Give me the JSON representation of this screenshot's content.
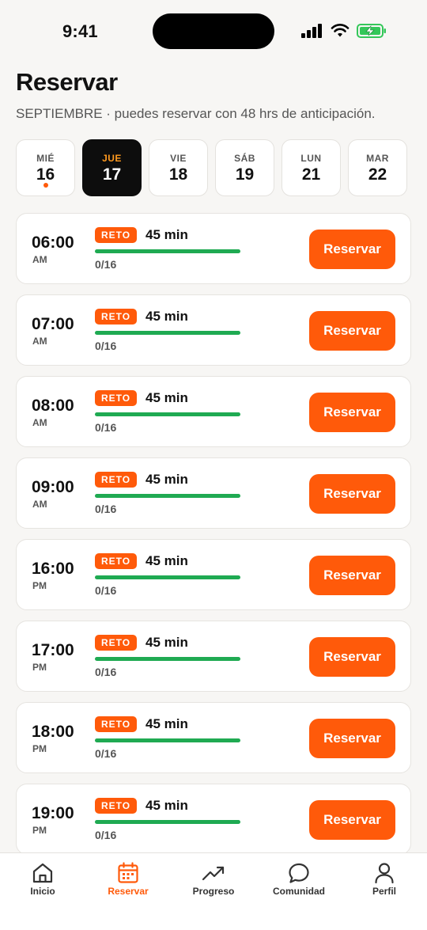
{
  "status_bar": {
    "time": "9:41"
  },
  "header": {
    "title": "Reservar",
    "subtitle": "SEPTIEMBRE · puedes reservar con 48 hrs de anticipación."
  },
  "dates": [
    {
      "dow": "MIÉ",
      "day": "16",
      "today_dot": true,
      "selected": false
    },
    {
      "dow": "JUE",
      "day": "17",
      "today_dot": false,
      "selected": true
    },
    {
      "dow": "VIE",
      "day": "18",
      "today_dot": false,
      "selected": false
    },
    {
      "dow": "SÁB",
      "day": "19",
      "today_dot": false,
      "selected": false
    },
    {
      "dow": "LUN",
      "day": "21",
      "today_dot": false,
      "selected": false
    },
    {
      "dow": "MAR",
      "day": "22",
      "today_dot": false,
      "selected": false
    }
  ],
  "slots": [
    {
      "time": "06:00",
      "ampm": "AM",
      "badge": "RETO",
      "duration": "45 min",
      "count": "0/16",
      "button": "Reservar"
    },
    {
      "time": "07:00",
      "ampm": "AM",
      "badge": "RETO",
      "duration": "45 min",
      "count": "0/16",
      "button": "Reservar"
    },
    {
      "time": "08:00",
      "ampm": "AM",
      "badge": "RETO",
      "duration": "45 min",
      "count": "0/16",
      "button": "Reservar"
    },
    {
      "time": "09:00",
      "ampm": "AM",
      "badge": "RETO",
      "duration": "45 min",
      "count": "0/16",
      "button": "Reservar"
    },
    {
      "time": "16:00",
      "ampm": "PM",
      "badge": "RETO",
      "duration": "45 min",
      "count": "0/16",
      "button": "Reservar"
    },
    {
      "time": "17:00",
      "ampm": "PM",
      "badge": "RETO",
      "duration": "45 min",
      "count": "0/16",
      "button": "Reservar"
    },
    {
      "time": "18:00",
      "ampm": "PM",
      "badge": "RETO",
      "duration": "45 min",
      "count": "0/16",
      "button": "Reservar"
    },
    {
      "time": "19:00",
      "ampm": "PM",
      "badge": "RETO",
      "duration": "45 min",
      "count": "0/16",
      "button": "Reservar"
    }
  ],
  "tabs": [
    {
      "label": "Inicio",
      "icon": "home-icon",
      "active": false
    },
    {
      "label": "Reservar",
      "icon": "calendar-icon",
      "active": true
    },
    {
      "label": "Progreso",
      "icon": "trending-up-icon",
      "active": false
    },
    {
      "label": "Comunidad",
      "icon": "chat-bubble-icon",
      "active": false
    },
    {
      "label": "Perfil",
      "icon": "user-icon",
      "active": false
    }
  ],
  "colors": {
    "accent": "#ff5a0a",
    "capacity_bar": "#1faa52",
    "selected_date_bg": "#0d0d0d",
    "selected_date_label": "#ff9a1f",
    "battery_charging": "#34c759"
  }
}
